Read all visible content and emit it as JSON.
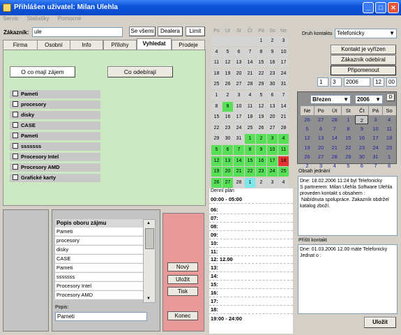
{
  "window": {
    "title": "Přihlášen uživatel: Milan Ulehla"
  },
  "menu": [
    "Servis",
    "Statistiky",
    "Pomocné"
  ],
  "customer": {
    "label": "Zákazník:",
    "value": "ule",
    "btn_all": "Se všemi",
    "btn_dealer": "Dealera",
    "btn_limit": "Limit"
  },
  "tabs": [
    "Firma",
    "Osobní",
    "Info",
    "Přílohy",
    "Vyhledat",
    "Prodeje"
  ],
  "search": {
    "interest_btn": "O co mají zájem",
    "buy_btn": "Co odebírají",
    "categories": [
      "Pameti",
      "procesory",
      "disky",
      "CASE",
      "Pameti",
      "sssssss",
      "Procesory Intel",
      "Procesory AMD",
      "Grafické karty"
    ]
  },
  "interest_list": {
    "header": "Popis oboru zájmu",
    "items": [
      "Pameti",
      "procesory",
      "disky",
      "CASE",
      "Pameti",
      "sssssss",
      "Procesory Intel",
      "Procesory AMD"
    ],
    "popis_label": "Popis:",
    "popis_value": "Pameti"
  },
  "side_buttons": {
    "new": "Nový",
    "save": "Uložit",
    "print": "Tisk",
    "end": "Konec"
  },
  "big_calendar": {
    "headers": [
      "Po",
      "Út",
      "St",
      "Čt",
      "Pá",
      "So",
      "Ne"
    ],
    "rows": [
      [
        "Po",
        "Út",
        "St",
        "Čt",
        "Pá",
        "So",
        "Ne"
      ],
      [
        "",
        "",
        "",
        "",
        "1",
        "2",
        "3"
      ],
      [
        "4",
        "5",
        "6",
        "7",
        "8",
        "9",
        "10"
      ],
      [
        "11",
        "12",
        "13",
        "14",
        "15",
        "16",
        "17"
      ],
      [
        "18",
        "19",
        "20",
        "21",
        "22",
        "23",
        "24"
      ],
      [
        "25",
        "26",
        "27",
        "28",
        "29",
        "30",
        "31"
      ],
      [
        "1",
        "2",
        "3",
        "4",
        "5",
        "6",
        "7"
      ],
      [
        "8",
        "9",
        "10",
        "11",
        "12",
        "13",
        "14"
      ],
      [
        "15",
        "16",
        "17",
        "18",
        "19",
        "20",
        "21"
      ],
      [
        "22",
        "23",
        "24",
        "25",
        "26",
        "27",
        "28"
      ],
      [
        "29",
        "30",
        "31",
        "1",
        "2",
        "3",
        "4"
      ],
      [
        "5",
        "6",
        "7",
        "8",
        "9",
        "10",
        "11"
      ],
      [
        "12",
        "13",
        "14",
        "15",
        "16",
        "17",
        "18"
      ],
      [
        "19",
        "20",
        "21",
        "22",
        "23",
        "24",
        "25"
      ],
      [
        "26",
        "27",
        "28",
        "1",
        "2",
        "3",
        "4"
      ]
    ]
  },
  "schedule": {
    "title": "Denní plán",
    "range_top": "00:00 - 05:00",
    "hours": [
      "06:",
      "07:",
      "08:",
      "09:",
      "10:",
      "11:",
      "12: 12.00",
      "13:",
      "14:",
      "15:",
      "16:",
      "17:",
      "18:"
    ],
    "range_bottom": "19:00 - 24:00"
  },
  "contact": {
    "type_label": "Druh kontaktu",
    "type_value": "Telefonicky",
    "btn_done": "Kontakt je vyřízen",
    "btn_bought": "Zákazník odebíral",
    "btn_remind": "Připomenout",
    "day": "1",
    "month": "3",
    "year": "2006",
    "hour": "12",
    "minute": "00"
  },
  "mini_calendar": {
    "month": "Březen",
    "year": "2006",
    "headers": [
      "Ne",
      "Po",
      "Út",
      "St",
      "Čt",
      "Pá",
      "So"
    ],
    "days": [
      [
        "26",
        "27",
        "28",
        "1",
        "2",
        "3",
        "4"
      ],
      [
        "5",
        "6",
        "7",
        "8",
        "9",
        "10",
        "11"
      ],
      [
        "12",
        "13",
        "14",
        "15",
        "16",
        "17",
        "18"
      ],
      [
        "19",
        "20",
        "21",
        "22",
        "23",
        "24",
        "25"
      ],
      [
        "26",
        "27",
        "28",
        "29",
        "30",
        "31",
        "1"
      ],
      [
        "2",
        "3",
        "4",
        "5",
        "6",
        "7",
        "8"
      ]
    ]
  },
  "obsah": {
    "label": "Obsah jednání",
    "text": "Dne: 18.02.2006 11:24 byl Telefonicky\nS partnerem: Milan Ulehla Software Ulehla\nproveden kontakt s obsahem :\n Nabídnuta spolupráce. Zakazník obdržel katalog zboží."
  },
  "next": {
    "label": "Příští kontakt",
    "text": "Dne: 01.03.2006 12.00 máte Telefonicky Jednat o :"
  },
  "save_btn": "Uložit"
}
